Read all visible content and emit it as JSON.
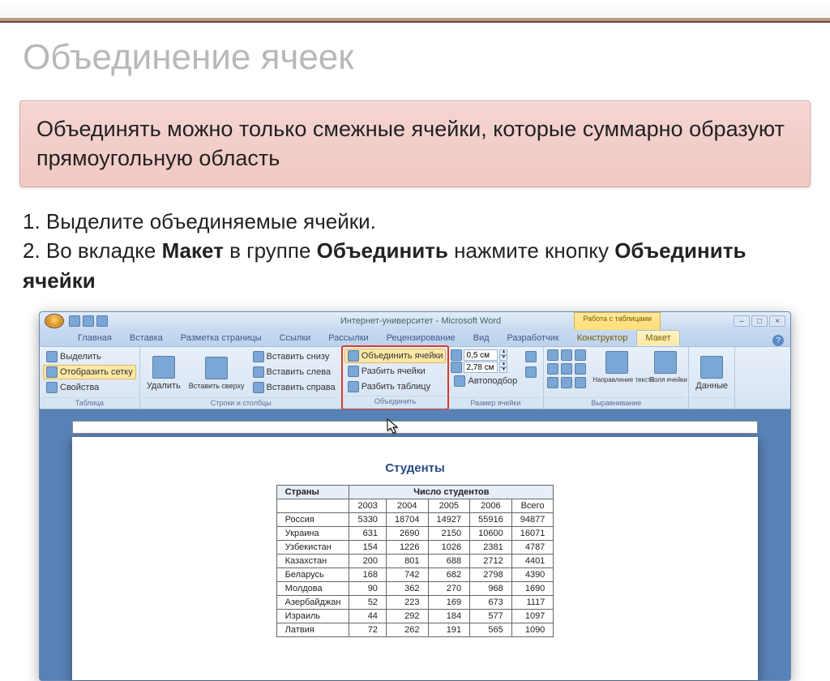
{
  "slide": {
    "title": "Объединение ячеек",
    "callout": "Объединять можно только смежные ячейки, которые суммарно образуют прямоугольную область",
    "instr_line1": "1. Выделите объединяемые ячейки.",
    "instr_line2_a": "2. Во вкладке ",
    "instr_line2_b": "Макет",
    "instr_line2_c": " в группе ",
    "instr_line2_d": "Объединить",
    "instr_line2_e": " нажмите кнопку ",
    "instr_line2_f": "Объединить ячейки"
  },
  "word": {
    "app_title": "Интернет-университет - Microsoft Word",
    "context_title": "Работа с таблицами",
    "tabs": {
      "home": "Главная",
      "insert": "Вставка",
      "pagelayout": "Разметка страницы",
      "refs": "Ссылки",
      "mail": "Рассылки",
      "review": "Рецензирование",
      "view": "Вид",
      "dev": "Разработчик",
      "design": "Конструктор",
      "layout": "Макет"
    },
    "ribbon": {
      "select": "Выделить",
      "showgrid": "Отобразить сетку",
      "props": "Свойства",
      "tablegrp": "Таблица",
      "delete": "Удалить",
      "ins_above": "Вставить сверху",
      "ins_below": "Вставить снизу",
      "ins_left": "Вставить слева",
      "ins_right": "Вставить справа",
      "rowscols": "Строки и столбцы",
      "merge_cells": "Объединить ячейки",
      "split_cells": "Разбить ячейки",
      "split_table": "Разбить таблицу",
      "merge": "Объединить",
      "h_val": "0,5 см",
      "w_val": "2,78 см",
      "autofit": "Автоподбор",
      "cellsize": "Размер ячейки",
      "textdir": "Направление текста",
      "cellmargins": "Поля ячейки",
      "align": "Выравнивание",
      "data": "Данные"
    },
    "winbtns": {
      "min": "–",
      "max": "□",
      "close": "×"
    }
  },
  "doc": {
    "title": "Студенты",
    "header_country": "Страны",
    "header_students": "Число студентов",
    "years": [
      "2003",
      "2004",
      "2005",
      "2006",
      "Всего"
    ],
    "rows": [
      {
        "c": "Россия",
        "v": [
          "5330",
          "18704",
          "14927",
          "55916",
          "94877"
        ]
      },
      {
        "c": "Украина",
        "v": [
          "631",
          "2690",
          "2150",
          "10600",
          "16071"
        ]
      },
      {
        "c": "Узбекистан",
        "v": [
          "154",
          "1226",
          "1026",
          "2381",
          "4787"
        ]
      },
      {
        "c": "Казахстан",
        "v": [
          "200",
          "801",
          "688",
          "2712",
          "4401"
        ]
      },
      {
        "c": "Беларусь",
        "v": [
          "168",
          "742",
          "682",
          "2798",
          "4390"
        ]
      },
      {
        "c": "Молдова",
        "v": [
          "90",
          "362",
          "270",
          "968",
          "1690"
        ]
      },
      {
        "c": "Азербайджан",
        "v": [
          "52",
          "223",
          "169",
          "673",
          "1117"
        ]
      },
      {
        "c": "Израиль",
        "v": [
          "44",
          "292",
          "184",
          "577",
          "1097"
        ]
      },
      {
        "c": "Латвия",
        "v": [
          "72",
          "262",
          "191",
          "565",
          "1090"
        ]
      }
    ]
  }
}
